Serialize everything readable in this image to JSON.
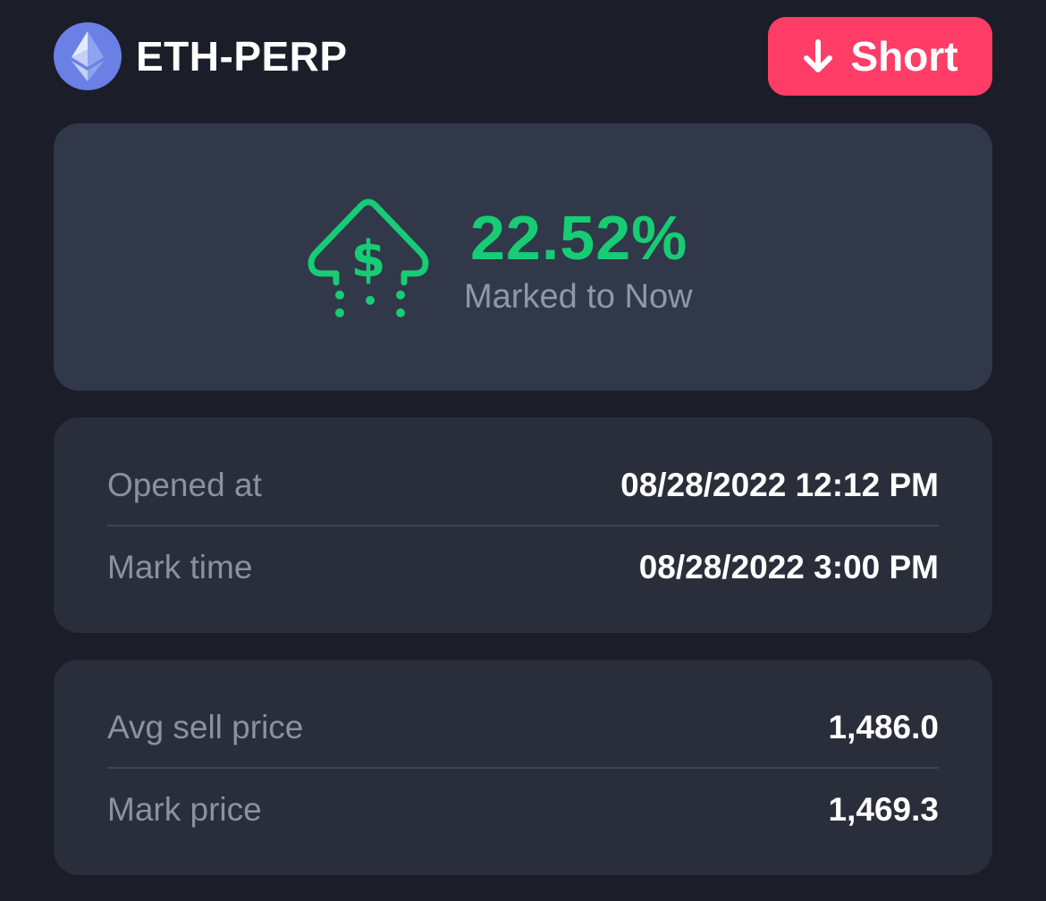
{
  "header": {
    "market": "ETH-PERP",
    "logo_icon": "ethereum-icon",
    "side_button": {
      "label": "Short",
      "icon": "arrow-down-icon",
      "color": "#ff3d67"
    }
  },
  "pnl": {
    "value": "22.52%",
    "label": "Marked to Now",
    "icon": "money-up-arrow-icon",
    "color": "#17cc74"
  },
  "times": {
    "opened_label": "Opened at",
    "opened_value": "08/28/2022 12:12 PM",
    "mark_label": "Mark time",
    "mark_value": "08/28/2022 3:00 PM"
  },
  "prices": {
    "avg_label": "Avg sell price",
    "avg_value": "1,486.0",
    "mark_label": "Mark price",
    "mark_value": "1,469.3"
  }
}
